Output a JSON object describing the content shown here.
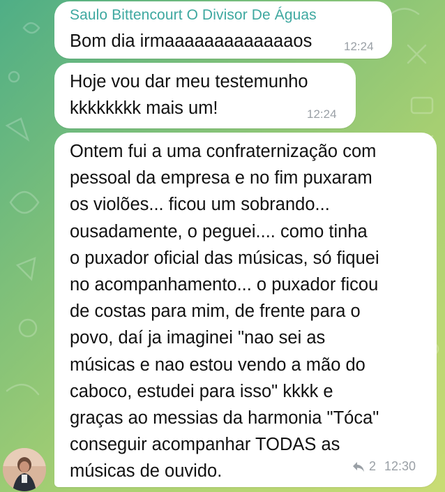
{
  "messages": [
    {
      "sender": "Saulo Bittencourt O Divisor De Águas",
      "text": "Bom dia irmaaaaaaaaaaaaaos",
      "time": "12:24"
    },
    {
      "line1": "Hoje vou dar meu testemunho",
      "line2": "kkkkkkkk mais um!",
      "time": "12:24"
    },
    {
      "lines": [
        "Ontem fui a uma confraternização com",
        "pessoal da empresa e no fim puxaram",
        "os violões... ficou um sobrando...",
        "ousadamente, o peguei.... como tinha",
        "o puxador oficial das músicas, só fiquei",
        "no acompanhamento... o puxador ficou",
        "de costas para mim, de frente para o",
        "povo, daí ja imaginei \"nao sei as",
        "músicas e nao estou vendo a mão do",
        "caboco, estudei para isso\" kkkk e",
        "graças ao messias da harmonia \"Tóca\"",
        "conseguir acompanhar TODAS as",
        "músicas de ouvido."
      ],
      "reply_count": "2",
      "time": "12:30"
    }
  ],
  "colors": {
    "sender_name": "#3ea8a0",
    "bubble": "#ffffff",
    "timestamp": "#9aa0a6",
    "wallpaper_start": "#4fae86",
    "wallpaper_end": "#c9dc74"
  },
  "icons": {
    "reply": "reply-arrow-icon",
    "avatar": "user-avatar"
  }
}
